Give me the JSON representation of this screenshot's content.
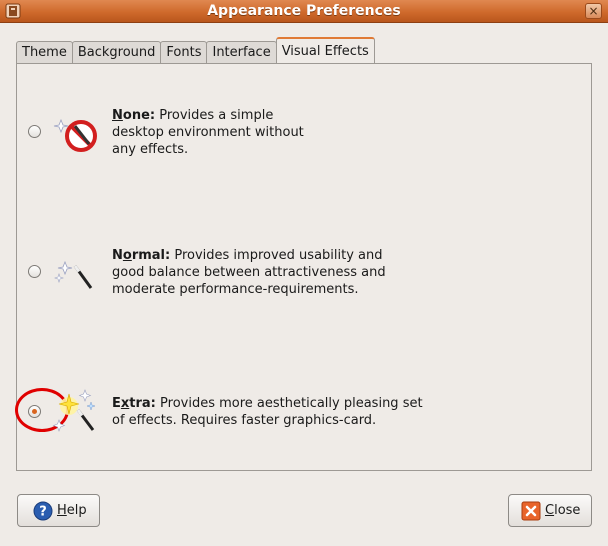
{
  "window": {
    "title": "Appearance Preferences",
    "close_glyph": "×"
  },
  "tabs": [
    {
      "label": "Theme",
      "active": false
    },
    {
      "label": "Background",
      "active": false
    },
    {
      "label": "Fonts",
      "active": false
    },
    {
      "label": "Interface",
      "active": false
    },
    {
      "label": "Visual Effects",
      "active": true
    }
  ],
  "effects": {
    "none": {
      "mnemonic": "N",
      "name_rest": "one:",
      "text": " Provides a simple\ndesktop environment without\nany effects.",
      "selected": false,
      "icon": "no-effects-icon"
    },
    "normal": {
      "mnemonic": "o",
      "name_before": "N",
      "name_rest": "rmal:",
      "text": " Provides improved usability and\ngood balance between attractiveness and\nmoderate performance-requirements.",
      "selected": false,
      "icon": "magic-wand-icon"
    },
    "extra": {
      "mnemonic": "x",
      "name_before": "E",
      "name_rest": "tra:",
      "text": " Provides more aesthetically pleasing set\nof effects. Requires faster graphics-card.",
      "selected": true,
      "icon": "sparkle-wand-icon"
    }
  },
  "buttons": {
    "help": {
      "mnemonic": "H",
      "rest": "elp",
      "icon": "help-icon"
    },
    "close": {
      "mnemonic": "C",
      "rest": "lose",
      "icon": "close-x-icon"
    }
  },
  "colors": {
    "titlebar": "#cf6a2c",
    "accent": "#e07a35",
    "highlight_circle": "#e00000"
  }
}
